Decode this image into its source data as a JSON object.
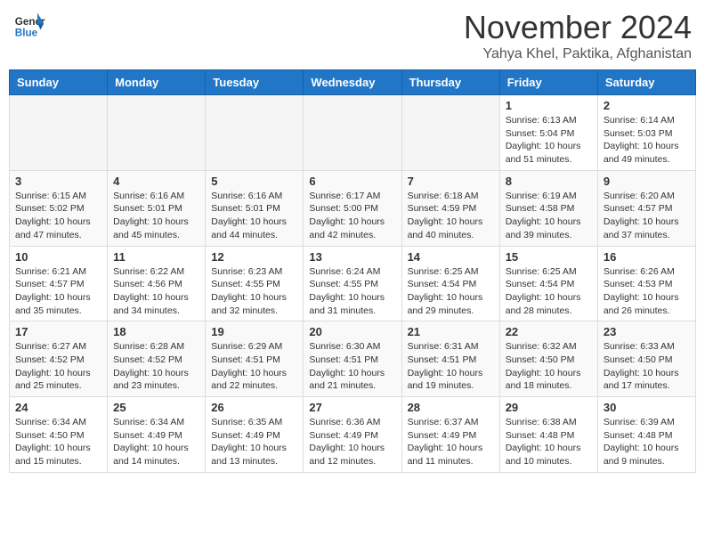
{
  "header": {
    "logo_general": "General",
    "logo_blue": "Blue",
    "month_title": "November 2024",
    "location": "Yahya Khel, Paktika, Afghanistan"
  },
  "weekdays": [
    "Sunday",
    "Monday",
    "Tuesday",
    "Wednesday",
    "Thursday",
    "Friday",
    "Saturday"
  ],
  "weeks": [
    [
      {
        "day": "",
        "info": ""
      },
      {
        "day": "",
        "info": ""
      },
      {
        "day": "",
        "info": ""
      },
      {
        "day": "",
        "info": ""
      },
      {
        "day": "",
        "info": ""
      },
      {
        "day": "1",
        "info": "Sunrise: 6:13 AM\nSunset: 5:04 PM\nDaylight: 10 hours\nand 51 minutes."
      },
      {
        "day": "2",
        "info": "Sunrise: 6:14 AM\nSunset: 5:03 PM\nDaylight: 10 hours\nand 49 minutes."
      }
    ],
    [
      {
        "day": "3",
        "info": "Sunrise: 6:15 AM\nSunset: 5:02 PM\nDaylight: 10 hours\nand 47 minutes."
      },
      {
        "day": "4",
        "info": "Sunrise: 6:16 AM\nSunset: 5:01 PM\nDaylight: 10 hours\nand 45 minutes."
      },
      {
        "day": "5",
        "info": "Sunrise: 6:16 AM\nSunset: 5:01 PM\nDaylight: 10 hours\nand 44 minutes."
      },
      {
        "day": "6",
        "info": "Sunrise: 6:17 AM\nSunset: 5:00 PM\nDaylight: 10 hours\nand 42 minutes."
      },
      {
        "day": "7",
        "info": "Sunrise: 6:18 AM\nSunset: 4:59 PM\nDaylight: 10 hours\nand 40 minutes."
      },
      {
        "day": "8",
        "info": "Sunrise: 6:19 AM\nSunset: 4:58 PM\nDaylight: 10 hours\nand 39 minutes."
      },
      {
        "day": "9",
        "info": "Sunrise: 6:20 AM\nSunset: 4:57 PM\nDaylight: 10 hours\nand 37 minutes."
      }
    ],
    [
      {
        "day": "10",
        "info": "Sunrise: 6:21 AM\nSunset: 4:57 PM\nDaylight: 10 hours\nand 35 minutes."
      },
      {
        "day": "11",
        "info": "Sunrise: 6:22 AM\nSunset: 4:56 PM\nDaylight: 10 hours\nand 34 minutes."
      },
      {
        "day": "12",
        "info": "Sunrise: 6:23 AM\nSunset: 4:55 PM\nDaylight: 10 hours\nand 32 minutes."
      },
      {
        "day": "13",
        "info": "Sunrise: 6:24 AM\nSunset: 4:55 PM\nDaylight: 10 hours\nand 31 minutes."
      },
      {
        "day": "14",
        "info": "Sunrise: 6:25 AM\nSunset: 4:54 PM\nDaylight: 10 hours\nand 29 minutes."
      },
      {
        "day": "15",
        "info": "Sunrise: 6:25 AM\nSunset: 4:54 PM\nDaylight: 10 hours\nand 28 minutes."
      },
      {
        "day": "16",
        "info": "Sunrise: 6:26 AM\nSunset: 4:53 PM\nDaylight: 10 hours\nand 26 minutes."
      }
    ],
    [
      {
        "day": "17",
        "info": "Sunrise: 6:27 AM\nSunset: 4:52 PM\nDaylight: 10 hours\nand 25 minutes."
      },
      {
        "day": "18",
        "info": "Sunrise: 6:28 AM\nSunset: 4:52 PM\nDaylight: 10 hours\nand 23 minutes."
      },
      {
        "day": "19",
        "info": "Sunrise: 6:29 AM\nSunset: 4:51 PM\nDaylight: 10 hours\nand 22 minutes."
      },
      {
        "day": "20",
        "info": "Sunrise: 6:30 AM\nSunset: 4:51 PM\nDaylight: 10 hours\nand 21 minutes."
      },
      {
        "day": "21",
        "info": "Sunrise: 6:31 AM\nSunset: 4:51 PM\nDaylight: 10 hours\nand 19 minutes."
      },
      {
        "day": "22",
        "info": "Sunrise: 6:32 AM\nSunset: 4:50 PM\nDaylight: 10 hours\nand 18 minutes."
      },
      {
        "day": "23",
        "info": "Sunrise: 6:33 AM\nSunset: 4:50 PM\nDaylight: 10 hours\nand 17 minutes."
      }
    ],
    [
      {
        "day": "24",
        "info": "Sunrise: 6:34 AM\nSunset: 4:50 PM\nDaylight: 10 hours\nand 15 minutes."
      },
      {
        "day": "25",
        "info": "Sunrise: 6:34 AM\nSunset: 4:49 PM\nDaylight: 10 hours\nand 14 minutes."
      },
      {
        "day": "26",
        "info": "Sunrise: 6:35 AM\nSunset: 4:49 PM\nDaylight: 10 hours\nand 13 minutes."
      },
      {
        "day": "27",
        "info": "Sunrise: 6:36 AM\nSunset: 4:49 PM\nDaylight: 10 hours\nand 12 minutes."
      },
      {
        "day": "28",
        "info": "Sunrise: 6:37 AM\nSunset: 4:49 PM\nDaylight: 10 hours\nand 11 minutes."
      },
      {
        "day": "29",
        "info": "Sunrise: 6:38 AM\nSunset: 4:48 PM\nDaylight: 10 hours\nand 10 minutes."
      },
      {
        "day": "30",
        "info": "Sunrise: 6:39 AM\nSunset: 4:48 PM\nDaylight: 10 hours\nand 9 minutes."
      }
    ]
  ]
}
